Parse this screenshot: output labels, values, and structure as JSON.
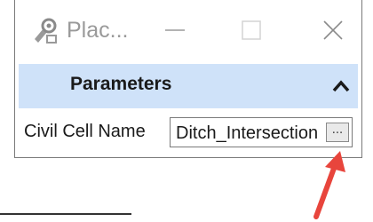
{
  "window": {
    "title": "Plac...",
    "icons": {
      "app": "civil-cell-icon",
      "minimize": "minimize-icon",
      "maximize": "maximize-icon",
      "close": "close-icon"
    }
  },
  "section": {
    "title": "Parameters",
    "collapse_icon": "chevron-up-icon",
    "header_color": "#cfe2f9"
  },
  "fields": {
    "civil_cell_name": {
      "label": "Civil Cell Name",
      "value": "Ditch_Intersection",
      "browse_label": "..."
    }
  },
  "annotation": {
    "arrow_color": "#e8453c"
  }
}
